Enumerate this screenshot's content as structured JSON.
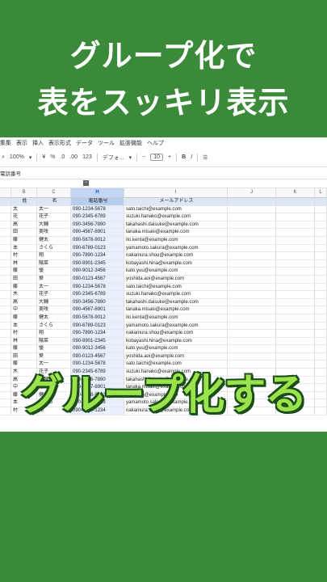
{
  "title": {
    "line1": "グループ化で",
    "line2": "表をスッキリ表示"
  },
  "overlay_text": "グループ化する",
  "menu": [
    "集集",
    "表示",
    "挿入",
    "表示形式",
    "データ",
    "ツール",
    "拡張機能",
    "ヘルプ"
  ],
  "toolbar": {
    "zoom": "100%",
    "currency": "¥",
    "percent": "%",
    "dec1": ".0",
    "dec2": ".00",
    "fmt123": "123",
    "font": "デフォ...",
    "minus": "−",
    "size": "10",
    "plus": "+",
    "bold": "B",
    "italic": "I"
  },
  "formula_ref": "電話番号",
  "col_headers": [
    "",
    "B",
    "C",
    "H",
    "I",
    "J",
    "K",
    "L"
  ],
  "header_row": [
    "",
    "姓",
    "名",
    "電話番号",
    "メールアドレス",
    "",
    "",
    ""
  ],
  "rows": [
    [
      "",
      "太",
      "太一",
      "090-1234-5678",
      "sato.taichi@example.com"
    ],
    [
      "",
      "花",
      "花子",
      "090-2345-6789",
      "suzuki.hanako@example.com"
    ],
    [
      "",
      "高",
      "大輔",
      "090-3456-7890",
      "takahashi.daisuke@example.com"
    ],
    [
      "",
      "田",
      "美咲",
      "090-4567-8901",
      "tanaka.misaki@example.com"
    ],
    [
      "",
      "藤",
      "健太",
      "090-5678-9012",
      "ito.kenta@example.com"
    ],
    [
      "",
      "本",
      "さくら",
      "090-6789-0123",
      "yamamoto.sakura@example.com"
    ],
    [
      "",
      "村",
      "翔",
      "090-7890-1234",
      "nakamura.shou@example.com"
    ],
    [
      "",
      "林",
      "陽菜",
      "090-8901-2345",
      "kobayashi.hina@example.com"
    ],
    [
      "",
      "藤",
      "優",
      "090-9012-3456",
      "kato.yuu@example.com"
    ],
    [
      "",
      "田",
      "葵",
      "090-0123-4567",
      "yoshida.aoi@example.com"
    ],
    [
      "",
      "藤",
      "太一",
      "090-1234-5678",
      "sato.taichi@example.com"
    ],
    [
      "",
      "木",
      "花子",
      "090-2345-6789",
      "suzuki.hanako@example.com"
    ],
    [
      "",
      "高",
      "大輔",
      "090-3456-7890",
      "takahashi.daisuke@example.com"
    ],
    [
      "",
      "中",
      "美咲",
      "090-4567-8901",
      "tanaka.misaki@example.com"
    ],
    [
      "",
      "藤",
      "健太",
      "090-5678-9012",
      "ito.kenta@example.com"
    ],
    [
      "",
      "本",
      "さくら",
      "090-6789-0123",
      "yamamoto.sakura@example.com"
    ],
    [
      "",
      "村",
      "翔",
      "090-7890-1234",
      "nakamura.shou@example.com"
    ],
    [
      "",
      "林",
      "陽菜",
      "090-8901-2345",
      "kobayashi.hina@example.com"
    ],
    [
      "",
      "藤",
      "優",
      "090-9012-3456",
      "kato.yuu@example.com"
    ],
    [
      "",
      "田",
      "葵",
      "090-0123-4567",
      "yoshida.aoi@example.com"
    ],
    [
      "",
      "藤",
      "太一",
      "090-1234-5678",
      "sato.taichi@example.com"
    ],
    [
      "",
      "木",
      "花子",
      "090-2345-6789",
      "suzuki.hanako@example.com"
    ],
    [
      "",
      "高",
      "大輔",
      "090-3456-7890",
      "takahashi.daisuke@example.com"
    ],
    [
      "",
      "中",
      "美咲",
      "090-4567-8901",
      "tanaka.misaki@example.com"
    ],
    [
      "",
      "藤",
      "健太",
      "090-5678-9012",
      "ito.kenta@example.com"
    ],
    [
      "",
      "本",
      "さくら",
      "090-6789-0123",
      "yamamoto.sakura@example.com"
    ],
    [
      "",
      "村",
      "翔",
      "090-7890-1234",
      "nakamura.shou@example.com"
    ]
  ],
  "colors": {
    "background": "#3a8a3a",
    "overlay_text": "#9be34a",
    "selected_col": "#c2d6f6"
  }
}
